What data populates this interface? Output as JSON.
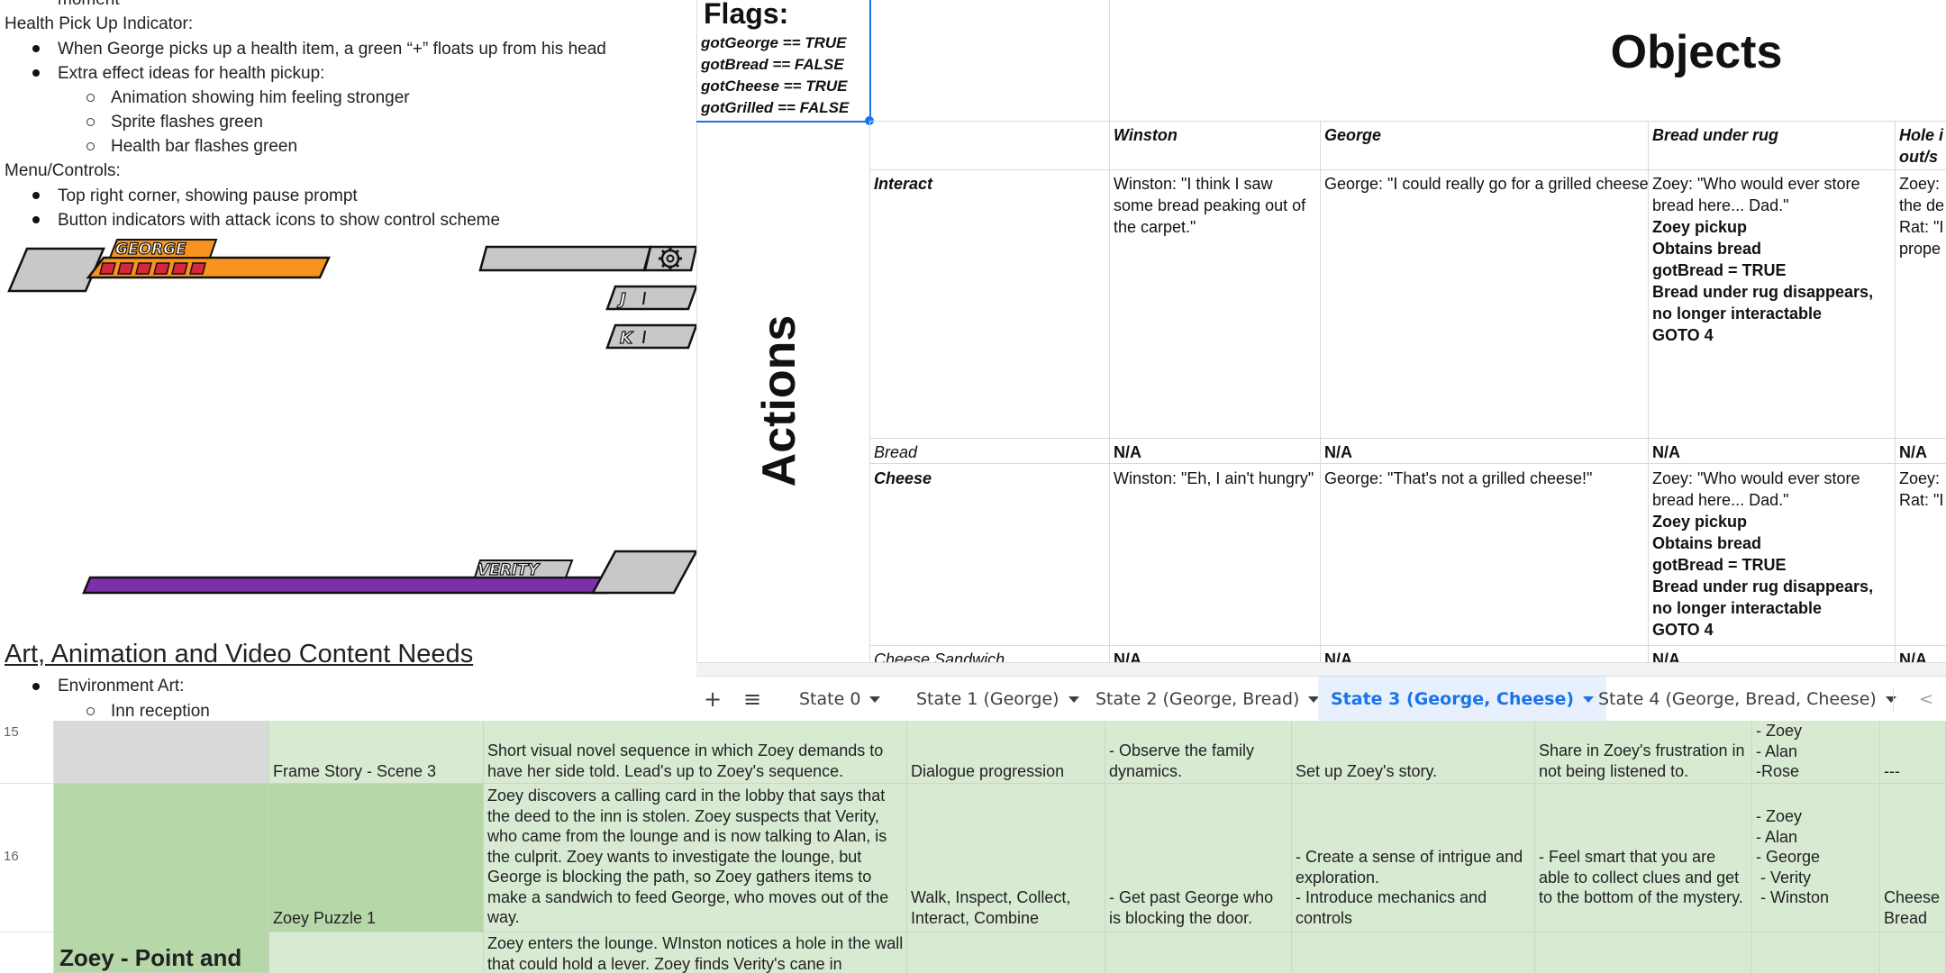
{
  "doc": {
    "cut_line": "moment",
    "health_title": "Health Pick Up Indicator:",
    "health_bullets": [
      "When George picks up a health item, a green “+” floats up from his head",
      "Extra effect ideas for health pickup:"
    ],
    "health_sub": [
      "Animation showing him feeling stronger",
      "Sprite flashes green",
      "Health bar flashes green"
    ],
    "menu_title": "Menu/Controls:",
    "menu_bullets": [
      "Top right corner, showing pause prompt",
      "Button indicators with attack icons to show control scheme"
    ],
    "hud": {
      "george_name": "GEORGE",
      "verity_name": "VERITY",
      "key_j": "J",
      "key_k": "K",
      "health_pips": 6,
      "orange": "#f7931e",
      "red": "#d7263d",
      "purple": "#7b2fa8",
      "gray": "#c8c8c8"
    },
    "section_heading": "Art, Animation and Video Content Needs",
    "env_bullet": "Environment Art:",
    "env_sub": "Inn reception"
  },
  "sheet": {
    "flags_title": "Flags:",
    "flags": [
      "gotGeorge == TRUE",
      "gotBread == FALSE",
      "gotCheese == TRUE",
      "gotGrilled == FALSE"
    ],
    "objects_title": "Objects",
    "actions_title": "Actions",
    "columns": [
      "Winston",
      "George",
      "Bread under rug",
      "Hole i\nout/s"
    ],
    "rows": [
      {
        "label": "Interact",
        "winston": "Winston: \"I think I saw some bread peaking out of the carpet.\"",
        "george": "George: \"I could really go for a grilled cheese",
        "bread_lines": [
          {
            "t": "Zoey: \"Who would ever store bread here... Dad.\"",
            "b": false
          },
          {
            "t": "Zoey pickup",
            "b": true
          },
          {
            "t": "Obtains bread",
            "b": true
          },
          {
            "t": "gotBread = TRUE",
            "b": true
          },
          {
            "t": "Bread under rug disappears, no longer interactable",
            "b": true
          },
          {
            "t": "GOTO 4",
            "b": true
          }
        ],
        "hole": "Zoey:\nthe de\nRat: \"I\nprope"
      },
      {
        "label": "Bread",
        "winston": "N/A",
        "george": "N/A",
        "bread": "N/A",
        "hole": "N/A"
      },
      {
        "label": "Cheese",
        "winston": "Winston: \"Eh, I ain't hungry\"",
        "george": "George: \"That's not a grilled cheese!\"",
        "bread_lines": [
          {
            "t": "Zoey: \"Who would ever store bread here... Dad.\"",
            "b": false
          },
          {
            "t": "Zoey pickup",
            "b": true
          },
          {
            "t": "Obtains bread",
            "b": true
          },
          {
            "t": "gotBread = TRUE",
            "b": true
          },
          {
            "t": "Bread under rug disappears, no longer interactable",
            "b": true
          },
          {
            "t": "GOTO 4",
            "b": true
          }
        ],
        "hole": "Zoey:\nRat: \"I"
      },
      {
        "label": "Cheese Sandwich",
        "winston": "N/A",
        "george": "N/A",
        "bread": "N/A",
        "hole": "N/A"
      }
    ]
  },
  "tabs": {
    "add": "+",
    "list": "≡",
    "items": [
      "State 0",
      "State 1 (George)",
      "State 2 (George, Bread)",
      "State 3 (George, Cheese)",
      "State 4 (George, Bread, Cheese)"
    ],
    "active_index": 3,
    "scroll_left": "<"
  },
  "grid2": {
    "rows": [
      {
        "num": "15",
        "section": "",
        "name": "Frame Story - Scene 3",
        "desc": "Short visual novel sequence in which Zoey demands to have her side told. Lead's up to Zoey's sequence.",
        "mechanics": "Dialogue progression",
        "goals": "- Observe the family dynamics.",
        "design": "Set up Zoey's story.",
        "feel": "Share in Zoey's frustration in not being listened to.",
        "chars": "- Zoey\n- Alan\n-Rose",
        "items": "---"
      },
      {
        "num": "16",
        "section": "",
        "name": "Zoey Puzzle 1",
        "desc": "Zoey discovers a calling card in the lobby that says that the deed to the inn is stolen. Zoey suspects that Verity, who came from the lounge and is now talking to Alan, is the culprit. Zoey wants to investigate the lounge, but George is blocking the path, so Zoey gathers items to make a sandwich to feed George, who moves out of the way.",
        "mechanics": "Walk, Inspect, Collect, Interact, Combine",
        "goals": "- Get past George who is blocking the door.",
        "design": "- Create a sense of intrigue and exploration.\n- Introduce mechanics and controls",
        "feel": "- Feel smart that you are able to collect clues and get to the bottom of the mystery.",
        "chars": "- Zoey\n- Alan\n- George\n - Verity\n - Winston",
        "items": "Cheese\nBread"
      },
      {
        "num": "",
        "section": "Zoey - Point and",
        "name": "",
        "desc": "Zoey enters the lounge. WInston notices a hole in the wall that could hold a lever. Zoey finds Verity's cane in",
        "mechanics": "",
        "goals": "",
        "design": "",
        "feel": "",
        "chars": "",
        "items": ""
      }
    ],
    "colors": {
      "green": "#d9ead3",
      "dark_green": "#b6d7a8",
      "gray": "#d9d9d9"
    }
  }
}
